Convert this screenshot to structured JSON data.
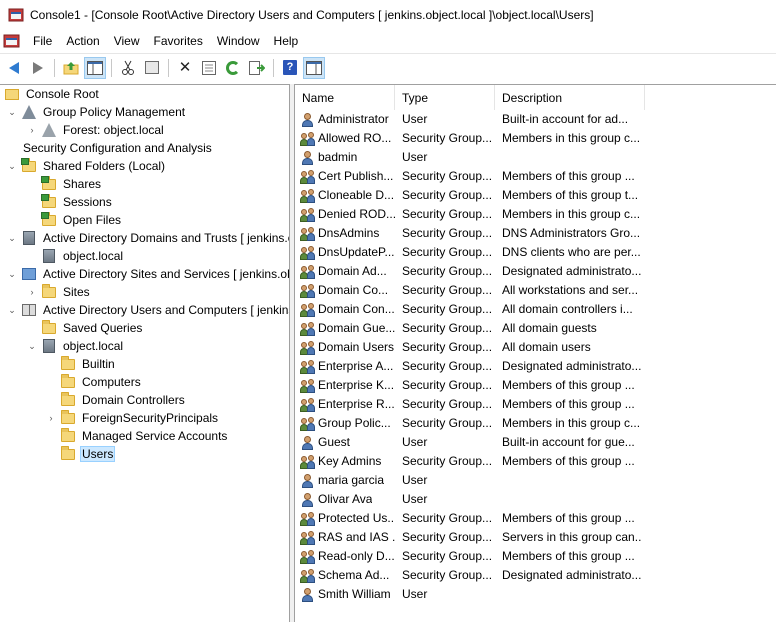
{
  "window": {
    "title": "Console1 - [Console Root\\Active Directory Users and Computers [ jenkins.object.local ]\\object.local\\Users]"
  },
  "menu": {
    "items": [
      "File",
      "Action",
      "View",
      "Favorites",
      "Window",
      "Help"
    ]
  },
  "toolbar": {
    "buttons": [
      "back-icon",
      "forward-icon",
      "up-folder-icon",
      "show-hide-tree-icon",
      "cut-icon",
      "copy-icon",
      "delete-icon",
      "properties-icon",
      "refresh-icon",
      "export-list-icon",
      "help-icon",
      "show-hide-action-pane-icon"
    ]
  },
  "tree": {
    "items": [
      {
        "label": "Console Root",
        "icon": "console-root-icon",
        "expander": ""
      },
      {
        "label": "Group Policy Management",
        "icon": "gpm-icon",
        "expander": "open"
      },
      {
        "label": "Forest: object.local",
        "icon": "forest-icon",
        "expander": "closed"
      },
      {
        "label": "Security Configuration and Analysis",
        "icon": "security-config-icon",
        "expander": ""
      },
      {
        "label": "Shared Folders (Local)",
        "icon": "shared-folders-icon",
        "expander": "open"
      },
      {
        "label": "Shares",
        "icon": "shares-icon",
        "expander": ""
      },
      {
        "label": "Sessions",
        "icon": "sessions-icon",
        "expander": ""
      },
      {
        "label": "Open Files",
        "icon": "open-files-icon",
        "expander": ""
      },
      {
        "label": "Active Directory Domains and Trusts [ jenkins.o",
        "icon": "domains-trusts-icon",
        "expander": "open"
      },
      {
        "label": "object.local",
        "icon": "domain-icon",
        "expander": ""
      },
      {
        "label": "Active Directory Sites and Services [ jenkins.obj",
        "icon": "sites-services-icon",
        "expander": "open"
      },
      {
        "label": "Sites",
        "icon": "folder-icon",
        "expander": "closed"
      },
      {
        "label": "Active Directory Users and Computers [ jenkins",
        "icon": "aduc-icon",
        "expander": "open"
      },
      {
        "label": "Saved Queries",
        "icon": "folder-icon",
        "expander": ""
      },
      {
        "label": "object.local",
        "icon": "domain-icon",
        "expander": "open"
      },
      {
        "label": "Builtin",
        "icon": "folder-icon",
        "expander": ""
      },
      {
        "label": "Computers",
        "icon": "folder-icon",
        "expander": ""
      },
      {
        "label": "Domain Controllers",
        "icon": "folder-icon",
        "expander": ""
      },
      {
        "label": "ForeignSecurityPrincipals",
        "icon": "folder-icon",
        "expander": "closed"
      },
      {
        "label": "Managed Service Accounts",
        "icon": "folder-icon",
        "expander": ""
      },
      {
        "label": "Users",
        "icon": "folder-icon",
        "expander": "",
        "selected": true
      }
    ]
  },
  "list": {
    "columns": [
      "Name",
      "Type",
      "Description"
    ],
    "rows": [
      {
        "name": "Administrator",
        "type": "User",
        "description": "Built-in account for ad...",
        "kind": "user"
      },
      {
        "name": "Allowed RO...",
        "type": "Security Group...",
        "description": "Members in this group c...",
        "kind": "group"
      },
      {
        "name": "badmin",
        "type": "User",
        "description": "",
        "kind": "user"
      },
      {
        "name": "Cert Publish...",
        "type": "Security Group...",
        "description": "Members of this group ...",
        "kind": "group"
      },
      {
        "name": "Cloneable D...",
        "type": "Security Group...",
        "description": "Members of this group t...",
        "kind": "group"
      },
      {
        "name": "Denied ROD...",
        "type": "Security Group...",
        "description": "Members in this group c...",
        "kind": "group"
      },
      {
        "name": "DnsAdmins",
        "type": "Security Group...",
        "description": "DNS Administrators Gro...",
        "kind": "group"
      },
      {
        "name": "DnsUpdateP...",
        "type": "Security Group...",
        "description": "DNS clients who are per...",
        "kind": "group"
      },
      {
        "name": "Domain Ad...",
        "type": "Security Group...",
        "description": "Designated administrato...",
        "kind": "group"
      },
      {
        "name": "Domain Co...",
        "type": "Security Group...",
        "description": "All workstations and ser...",
        "kind": "group"
      },
      {
        "name": "Domain Con...",
        "type": "Security Group...",
        "description": "All domain controllers i...",
        "kind": "group"
      },
      {
        "name": "Domain Gue...",
        "type": "Security Group...",
        "description": "All domain guests",
        "kind": "group"
      },
      {
        "name": "Domain Users",
        "type": "Security Group...",
        "description": "All domain users",
        "kind": "group"
      },
      {
        "name": "Enterprise A...",
        "type": "Security Group...",
        "description": "Designated administrato...",
        "kind": "group"
      },
      {
        "name": "Enterprise K...",
        "type": "Security Group...",
        "description": "Members of this group ...",
        "kind": "group"
      },
      {
        "name": "Enterprise R...",
        "type": "Security Group...",
        "description": "Members of this group ...",
        "kind": "group"
      },
      {
        "name": "Group Polic...",
        "type": "Security Group...",
        "description": "Members in this group c...",
        "kind": "group"
      },
      {
        "name": "Guest",
        "type": "User",
        "description": "Built-in account for gue...",
        "kind": "user"
      },
      {
        "name": "Key Admins",
        "type": "Security Group...",
        "description": "Members of this group ...",
        "kind": "group"
      },
      {
        "name": "maria garcia",
        "type": "User",
        "description": "",
        "kind": "user"
      },
      {
        "name": "Olivar Ava",
        "type": "User",
        "description": "",
        "kind": "user"
      },
      {
        "name": "Protected Us...",
        "type": "Security Group...",
        "description": "Members of this group ...",
        "kind": "group"
      },
      {
        "name": "RAS and IAS ...",
        "type": "Security Group...",
        "description": "Servers in this group can...",
        "kind": "group"
      },
      {
        "name": "Read-only D...",
        "type": "Security Group...",
        "description": "Members of this group ...",
        "kind": "group"
      },
      {
        "name": "Schema Ad...",
        "type": "Security Group...",
        "description": "Designated administrato...",
        "kind": "group"
      },
      {
        "name": "Smith William",
        "type": "User",
        "description": "",
        "kind": "user"
      }
    ]
  }
}
